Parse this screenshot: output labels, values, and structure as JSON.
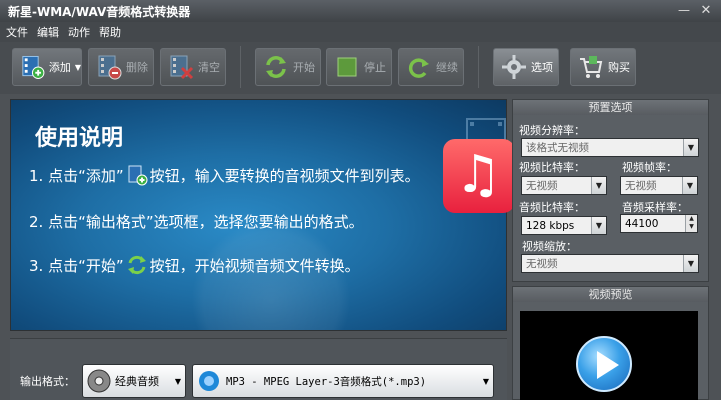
{
  "window": {
    "title": "新星-WMA/WAV音频格式转换器",
    "minimize_glyph": "—",
    "close_glyph": "✕"
  },
  "menu": [
    "文件",
    "编辑",
    "动作",
    "帮助"
  ],
  "toolbar": {
    "add": "添加",
    "delete": "删除",
    "clear": "清空",
    "start": "开始",
    "stop": "停止",
    "resume": "继续",
    "options": "选项",
    "buy": "购买"
  },
  "banner": {
    "heading": "使用说明",
    "line1_a": "1. 点击“添加”",
    "line1_b": "按钮，输入要转换的音视频文件到列表。",
    "line2": "2. 点击“输出格式”选项框，选择您要输出的格式。",
    "line3_a": "3. 点击“开始”",
    "line3_b": "按钮，开始视频音频文件转换。"
  },
  "output": {
    "label": "输出格式：",
    "preset": "经典音频",
    "format": "MP3 - MPEG Layer-3音频格式(*.mp3)"
  },
  "preset_panel": {
    "title": "预置选项",
    "resolution_label": "视频分辨率：",
    "resolution_value": "该格式无视频",
    "video_bitrate_label": "视频比特率：",
    "video_bitrate_value": "无视频",
    "framerate_label": "视频帧率：",
    "framerate_value": "无视频",
    "audio_bitrate_label": "音频比特率：",
    "audio_bitrate_value": "128 kbps",
    "samplerate_label": "音频采样率：",
    "samplerate_value": "44100",
    "zoom_label": "视频缩放：",
    "zoom_value": "无视频"
  },
  "preview_panel": {
    "title": "视频预览"
  }
}
